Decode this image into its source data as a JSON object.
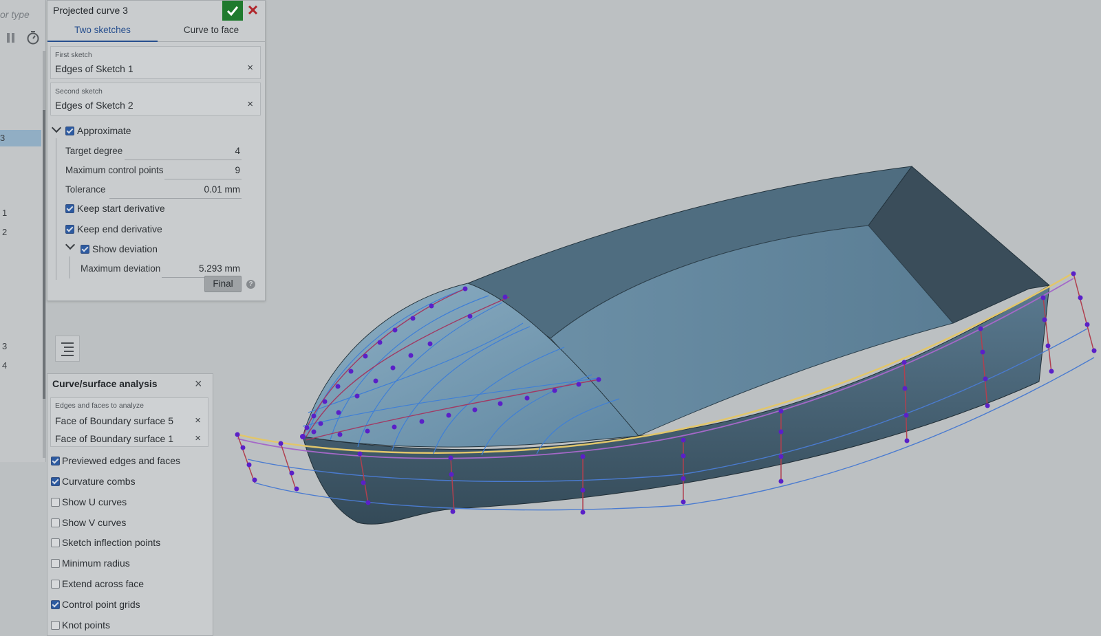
{
  "feature_list": {
    "filter_placeholder": "or type",
    "selected_row_text": "3",
    "row_numbers": [
      "1",
      "2",
      "3",
      "4"
    ]
  },
  "projected_curve": {
    "title": "Projected curve 3",
    "tabs": [
      "Two sketches",
      "Curve to face"
    ],
    "first_sketch": {
      "label": "First sketch",
      "value": "Edges of Sketch 1"
    },
    "second_sketch": {
      "label": "Second sketch",
      "value": "Edges of Sketch 2"
    },
    "approximate_label": "Approximate",
    "target_degree": {
      "label": "Target degree",
      "value": "4"
    },
    "max_control_points": {
      "label": "Maximum control points",
      "value": "9"
    },
    "tolerance": {
      "label": "Tolerance",
      "value": "0.01 mm"
    },
    "keep_start_derivative": "Keep start derivative",
    "keep_end_derivative": "Keep end derivative",
    "show_deviation": "Show deviation",
    "max_deviation": {
      "label": "Maximum deviation",
      "value": "5.293 mm"
    },
    "final_button": "Final",
    "help_glyph": "?",
    "remove_glyph": "×"
  },
  "analysis": {
    "title": "Curve/surface analysis",
    "faces_label": "Edges and faces to analyze",
    "faces": [
      "Face of Boundary surface 5",
      "Face of Boundary surface 1"
    ],
    "options": [
      {
        "label": "Previewed edges and faces",
        "checked": true
      },
      {
        "label": "Curvature combs",
        "checked": true
      },
      {
        "label": "Show U curves",
        "checked": false
      },
      {
        "label": "Show V curves",
        "checked": false
      },
      {
        "label": "Sketch inflection points",
        "checked": false
      },
      {
        "label": "Minimum radius",
        "checked": false
      },
      {
        "label": "Extend across face",
        "checked": false
      },
      {
        "label": "Control point grids",
        "checked": true
      },
      {
        "label": "Knot points",
        "checked": false
      }
    ]
  },
  "colors": {
    "accept_green": "#1f7a2e",
    "cancel_red": "#b0262b",
    "tab_blue": "#274f8e",
    "hull_light": "#6e95ac",
    "hull_dark": "#3e5565",
    "control_point": "#5a20c8",
    "comb_line": "#9a3a5c",
    "curve_yellow": "#e2c66a"
  }
}
